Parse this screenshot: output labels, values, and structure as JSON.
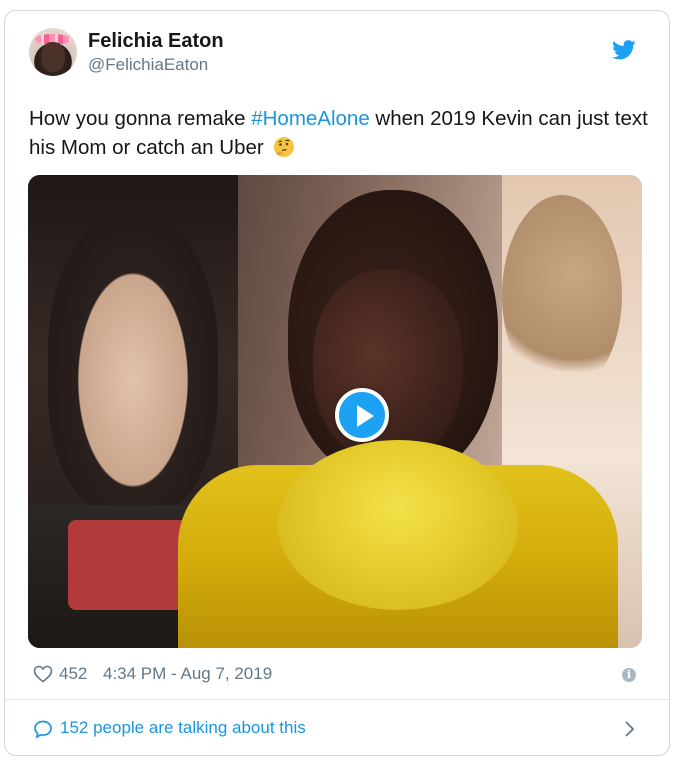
{
  "author": {
    "name": "Felichia Eaton",
    "handle": "@FelichiaEaton"
  },
  "tweet": {
    "text_before": "How you gonna remake ",
    "hashtag": "#HomeAlone",
    "text_after": " when 2019 Kevin can just text his Mom or catch an Uber",
    "emoji_icon": "thinking-face-icon"
  },
  "media": {
    "type": "video",
    "play_icon": "play-icon"
  },
  "stats": {
    "likes": "452",
    "timestamp": "4:34 PM - Aug 7, 2019"
  },
  "footer": {
    "talking_label": "152 people are talking about this"
  },
  "colors": {
    "link": "#1b95e0",
    "play": "#1da1f2",
    "muted": "#657786",
    "border": "#cfd9de"
  }
}
